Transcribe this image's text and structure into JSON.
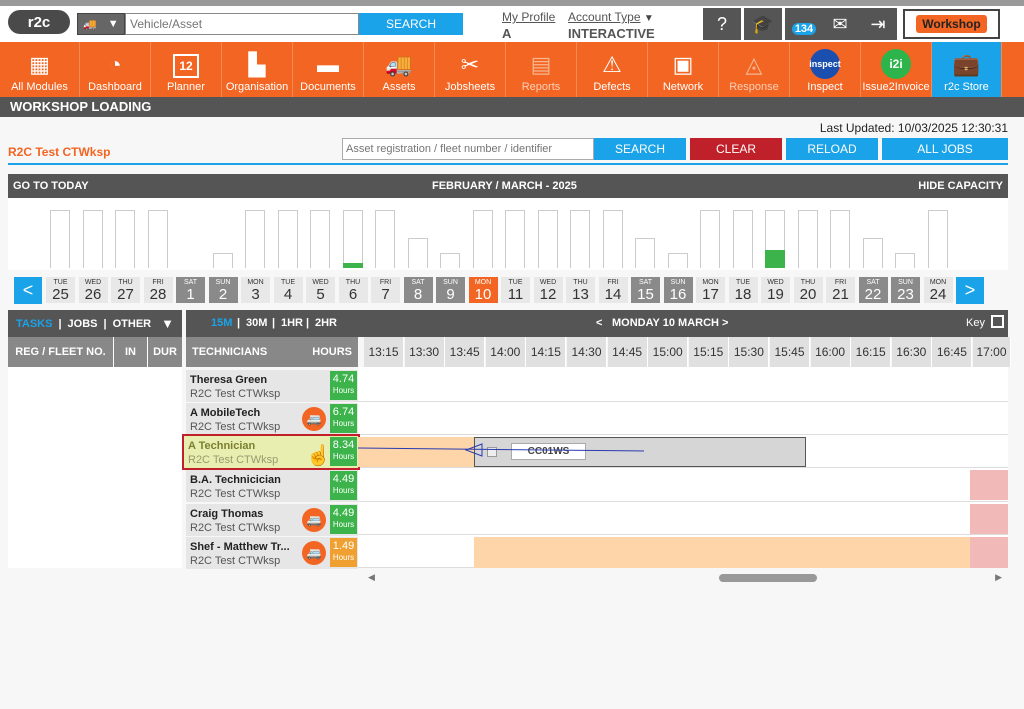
{
  "header": {
    "logo": "r2c",
    "vehicle_placeholder": "Vehicle/Asset",
    "search_label": "SEARCH",
    "my_profile_label": "My Profile",
    "profile_value": "A",
    "account_type_label": "Account Type",
    "account_type_value": "INTERACTIVE",
    "badge_count": "134",
    "workshop_logo": "Workshop"
  },
  "nav": {
    "items": [
      {
        "label": "All Modules",
        "icon": "grid-icon"
      },
      {
        "label": "Dashboard",
        "icon": "gauge-icon"
      },
      {
        "label": "Planner",
        "icon": "calendar-icon",
        "badge": "12"
      },
      {
        "label": "Organisation",
        "icon": "buildings-icon"
      },
      {
        "label": "Documents",
        "icon": "folder-icon"
      },
      {
        "label": "Assets",
        "icon": "truck-icon"
      },
      {
        "label": "Jobsheets",
        "icon": "tools-icon"
      },
      {
        "label": "Reports",
        "icon": "clipboard-icon"
      },
      {
        "label": "Defects",
        "icon": "warning-icon"
      },
      {
        "label": "Network",
        "icon": "contacts-icon"
      },
      {
        "label": "Response",
        "icon": "response-icon"
      },
      {
        "label": "Inspect",
        "icon": "inspect-icon",
        "badge": "inspect"
      },
      {
        "label": "Issue2Invoice",
        "icon": "i2i-icon",
        "badge": "i2i"
      },
      {
        "label": "r2c Store",
        "icon": "briefcase-icon"
      }
    ]
  },
  "section_title": "WORKSHOP LOADING",
  "last_updated": "Last Updated: 10/03/2025 12:30:31",
  "workshop_name": "R2C Test CTWksp",
  "asset_search": {
    "placeholder": "Asset registration / fleet number / identifier",
    "search_label": "SEARCH",
    "clear_label": "CLEAR",
    "reload_label": "RELOAD",
    "alljobs_label": "ALL JOBS"
  },
  "calendar": {
    "go_today": "GO TO TODAY",
    "range_label": "FEBRUARY / MARCH - 2025",
    "hide_capacity": "HIDE CAPACITY",
    "prev": "<",
    "next": ">",
    "days": [
      {
        "dn": "TUE",
        "dd": "25",
        "type": "weekday",
        "cap": 0.88,
        "fill": 0
      },
      {
        "dn": "WED",
        "dd": "26",
        "type": "weekday",
        "cap": 0.88,
        "fill": 0
      },
      {
        "dn": "THU",
        "dd": "27",
        "type": "weekday",
        "cap": 0.88,
        "fill": 0
      },
      {
        "dn": "FRI",
        "dd": "28",
        "type": "weekday",
        "cap": 0.88,
        "fill": 0
      },
      {
        "dn": "SAT",
        "dd": "1",
        "type": "weekend",
        "cap": 0,
        "fill": 0
      },
      {
        "dn": "SUN",
        "dd": "2",
        "type": "weekend",
        "cap": 0.22,
        "fill": 0
      },
      {
        "dn": "MON",
        "dd": "3",
        "type": "weekday",
        "cap": 0.88,
        "fill": 0
      },
      {
        "dn": "TUE",
        "dd": "4",
        "type": "weekday",
        "cap": 0.88,
        "fill": 0
      },
      {
        "dn": "WED",
        "dd": "5",
        "type": "weekday",
        "cap": 0.88,
        "fill": 0
      },
      {
        "dn": "THU",
        "dd": "6",
        "type": "weekday",
        "cap": 0.88,
        "fill": 0.07
      },
      {
        "dn": "FRI",
        "dd": "7",
        "type": "weekday",
        "cap": 0.88,
        "fill": 0
      },
      {
        "dn": "SAT",
        "dd": "8",
        "type": "weekend",
        "cap": 0.45,
        "fill": 0
      },
      {
        "dn": "SUN",
        "dd": "9",
        "type": "weekend",
        "cap": 0.22,
        "fill": 0
      },
      {
        "dn": "MON",
        "dd": "10",
        "type": "today",
        "cap": 0.88,
        "fill": 0
      },
      {
        "dn": "TUE",
        "dd": "11",
        "type": "weekday",
        "cap": 0.88,
        "fill": 0
      },
      {
        "dn": "WED",
        "dd": "12",
        "type": "weekday",
        "cap": 0.88,
        "fill": 0
      },
      {
        "dn": "THU",
        "dd": "13",
        "type": "weekday",
        "cap": 0.88,
        "fill": 0
      },
      {
        "dn": "FRI",
        "dd": "14",
        "type": "weekday",
        "cap": 0.88,
        "fill": 0
      },
      {
        "dn": "SAT",
        "dd": "15",
        "type": "weekend",
        "cap": 0.45,
        "fill": 0
      },
      {
        "dn": "SUN",
        "dd": "16",
        "type": "weekend",
        "cap": 0.22,
        "fill": 0
      },
      {
        "dn": "MON",
        "dd": "17",
        "type": "weekday",
        "cap": 0.88,
        "fill": 0
      },
      {
        "dn": "TUE",
        "dd": "18",
        "type": "weekday",
        "cap": 0.88,
        "fill": 0
      },
      {
        "dn": "WED",
        "dd": "19",
        "type": "weekday",
        "cap": 0.88,
        "fill": 0.27
      },
      {
        "dn": "THU",
        "dd": "20",
        "type": "weekday",
        "cap": 0.88,
        "fill": 0
      },
      {
        "dn": "FRI",
        "dd": "21",
        "type": "weekday",
        "cap": 0.88,
        "fill": 0
      },
      {
        "dn": "SAT",
        "dd": "22",
        "type": "weekend",
        "cap": 0.45,
        "fill": 0
      },
      {
        "dn": "SUN",
        "dd": "23",
        "type": "weekend",
        "cap": 0.22,
        "fill": 0
      },
      {
        "dn": "MON",
        "dd": "24",
        "type": "weekday",
        "cap": 0.88,
        "fill": 0
      }
    ]
  },
  "left_panel": {
    "tasks": "TASKS",
    "jobs": "JOBS",
    "other": "OTHER",
    "col_reg": "REG / FLEET NO.",
    "col_in": "IN",
    "col_dur": "DUR"
  },
  "schedule": {
    "zoom": [
      "15M",
      "30M",
      "1HR",
      "2HR"
    ],
    "date_label": "MONDAY 10 MARCH",
    "key_label": "Key",
    "technicians_label": "TECHNICIANS",
    "hours_label": "HOURS",
    "times": [
      "13:15",
      "13:30",
      "13:45",
      "14:00",
      "14:15",
      "14:30",
      "14:45",
      "15:00",
      "15:15",
      "15:30",
      "15:45",
      "16:00",
      "16:15",
      "16:30",
      "16:45",
      "17:00"
    ],
    "technicians": [
      {
        "name": "Theresa Green",
        "workshop": "R2C Test CTWksp",
        "hours": "4.74",
        "hours_unit": "Hours",
        "color": "#3cb44b",
        "van": false
      },
      {
        "name": "A MobileTech",
        "workshop": "R2C Test CTWksp",
        "hours": "6.74",
        "hours_unit": "Hours",
        "color": "#3cb44b",
        "van": true
      },
      {
        "name": "A Technician",
        "workshop": "R2C Test CTWksp",
        "hours": "8.34",
        "hours_unit": "Hours",
        "color": "#3cb44b",
        "van": false,
        "selected": true
      },
      {
        "name": "B.A. Technicician",
        "workshop": "R2C Test CTWksp",
        "hours": "4.49",
        "hours_unit": "Hours",
        "color": "#3cb44b",
        "van": false
      },
      {
        "name": "Craig Thomas",
        "workshop": "R2C Test CTWksp",
        "hours": "4.49",
        "hours_unit": "Hours",
        "color": "#3cb44b",
        "van": true
      },
      {
        "name": "Shef - Matthew Tr...",
        "workshop": "R2C Test CTWksp",
        "hours": "1.49",
        "hours_unit": "Hours",
        "color": "#f0a030",
        "van": true
      }
    ],
    "job_label": "CC01WS"
  }
}
